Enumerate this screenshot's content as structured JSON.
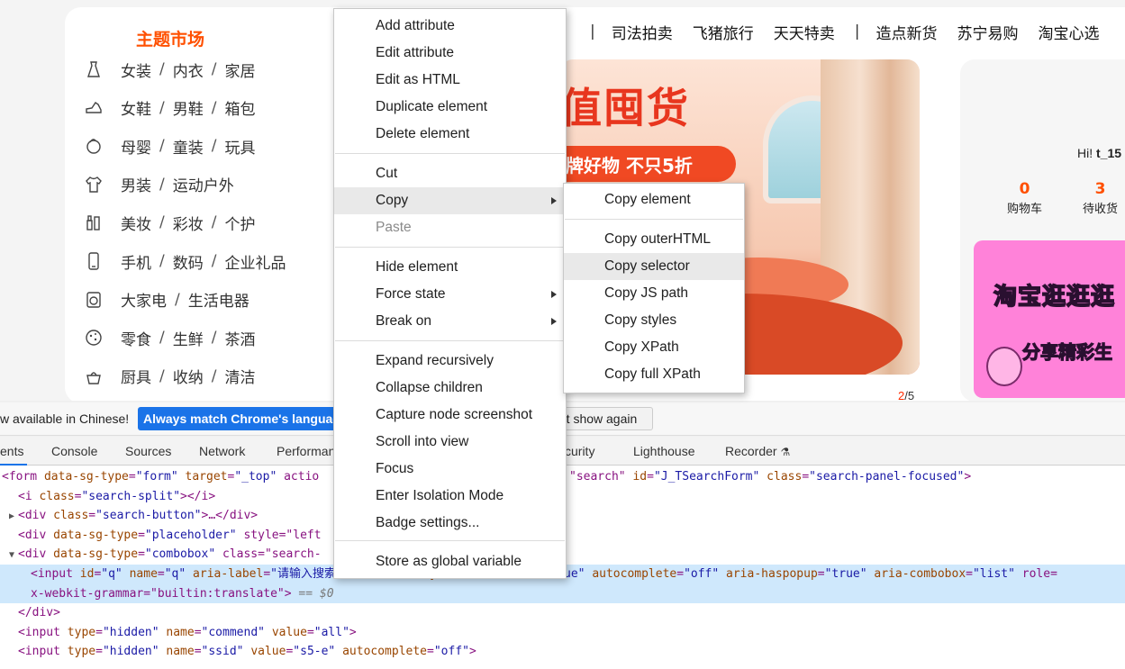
{
  "webpage": {
    "theme_title": "主题市场",
    "categories": [
      {
        "icon": "dress-icon",
        "links": [
          "女装",
          "内衣",
          "家居"
        ]
      },
      {
        "icon": "shoe-icon",
        "links": [
          "女鞋",
          "男鞋",
          "箱包"
        ]
      },
      {
        "icon": "baby-icon",
        "links": [
          "母婴",
          "童装",
          "玩具"
        ]
      },
      {
        "icon": "shirt-icon",
        "links": [
          "男装",
          "运动户外"
        ]
      },
      {
        "icon": "cosmetics-icon",
        "links": [
          "美妆",
          "彩妆",
          "个护"
        ]
      },
      {
        "icon": "phone-icon",
        "links": [
          "手机",
          "数码",
          "企业礼品"
        ]
      },
      {
        "icon": "appliance-icon",
        "links": [
          "大家电",
          "生活电器"
        ]
      },
      {
        "icon": "snack-icon",
        "links": [
          "零食",
          "生鲜",
          "茶酒"
        ]
      },
      {
        "icon": "kitchen-icon",
        "links": [
          "厨具",
          "收纳",
          "清洁"
        ]
      }
    ],
    "nav_links": [
      "司法拍卖",
      "飞猪旅行",
      "天天特卖",
      "造点新货",
      "苏宁易购",
      "淘宝心选"
    ],
    "banner": {
      "headline": "值囤货",
      "subline": "牌好物 不只5折",
      "page_current": "2",
      "page_total": "/5"
    },
    "user": {
      "greeting": "Hi! ",
      "username": "t_15",
      "cart_count": "0",
      "cart_label": "购物车",
      "pending_count": "3",
      "pending_label": "待收货"
    },
    "promo": {
      "title": "淘宝逛逛逛",
      "subtitle": "分享精彩生"
    }
  },
  "translate_bar": {
    "message": "w available in Chinese!",
    "always_button": "Always match Chrome's language",
    "never_button": "'t show again"
  },
  "devtools": {
    "tabs": [
      "ents",
      "Console",
      "Sources",
      "Network",
      "Performan",
      "curity",
      "Lighthouse",
      "Recorder"
    ],
    "code_lines": [
      {
        "indent": 0,
        "tri": "",
        "text": "<form data-sg-type=\"form\" target=\"_top\" actio",
        "tail": "\"search\" id=\"J_TSearchForm\" class=\"search-panel-focused\">"
      },
      {
        "indent": 1,
        "tri": "",
        "text": "<i class=\"search-split\"></i>",
        "tail": ""
      },
      {
        "indent": 1,
        "tri": "▶",
        "text": "<div class=\"search-button\">…</div>",
        "tail": ""
      },
      {
        "indent": 1,
        "tri": "",
        "text": "<div data-sg-type=\"placeholder\" style=\"left",
        "tail": ""
      },
      {
        "indent": 1,
        "tri": "▼",
        "text": "<div data-sg-type=\"combobox\" class=\"search-",
        "tail": ""
      },
      {
        "indent": 2,
        "tri": "",
        "text": "<input id=\"q\" name=\"q\" aria-label=\"请输入搜索文字\" accesskey=\"s\" autofocus=\"true\" autocomplete=\"off\" aria-haspopup=\"true\" aria-combobox=\"list\" role=",
        "tail": ""
      },
      {
        "indent": 2,
        "tri": "",
        "text": "x-webkit-grammar=\"builtin:translate\"> == $0",
        "tail": ""
      },
      {
        "indent": 1,
        "tri": "",
        "text": "</div>",
        "tail": ""
      },
      {
        "indent": 1,
        "tri": "",
        "text": "<input type=\"hidden\" name=\"commend\" value=\"all\">",
        "tail": ""
      },
      {
        "indent": 1,
        "tri": "",
        "text": "<input type=\"hidden\" name=\"ssid\" value=\"s5-e\" autocomplete=\"off\">",
        "tail": ""
      }
    ]
  },
  "context_menu": {
    "items": [
      {
        "label": "Add attribute",
        "top": 0
      },
      {
        "label": "Edit attribute"
      },
      {
        "label": "Edit as HTML"
      },
      {
        "label": "Duplicate element"
      },
      {
        "label": "Delete element"
      },
      {
        "label": "Cut"
      },
      {
        "label": "Copy",
        "submenu": true,
        "highlighted": true
      },
      {
        "label": "Paste",
        "disabled": true
      },
      {
        "label": "Hide element"
      },
      {
        "label": "Force state",
        "submenu": true
      },
      {
        "label": "Break on",
        "submenu": true
      },
      {
        "label": "Expand recursively"
      },
      {
        "label": "Collapse children"
      },
      {
        "label": "Capture node screenshot"
      },
      {
        "label": "Scroll into view"
      },
      {
        "label": "Focus"
      },
      {
        "label": "Enter Isolation Mode"
      },
      {
        "label": "Badge settings..."
      },
      {
        "label": "Store as global variable"
      }
    ]
  },
  "copy_submenu": {
    "items": [
      {
        "label": "Copy element"
      },
      {
        "label": "Copy outerHTML"
      },
      {
        "label": "Copy selector",
        "highlighted": true
      },
      {
        "label": "Copy JS path"
      },
      {
        "label": "Copy styles"
      },
      {
        "label": "Copy XPath"
      },
      {
        "label": "Copy full XPath"
      }
    ]
  }
}
